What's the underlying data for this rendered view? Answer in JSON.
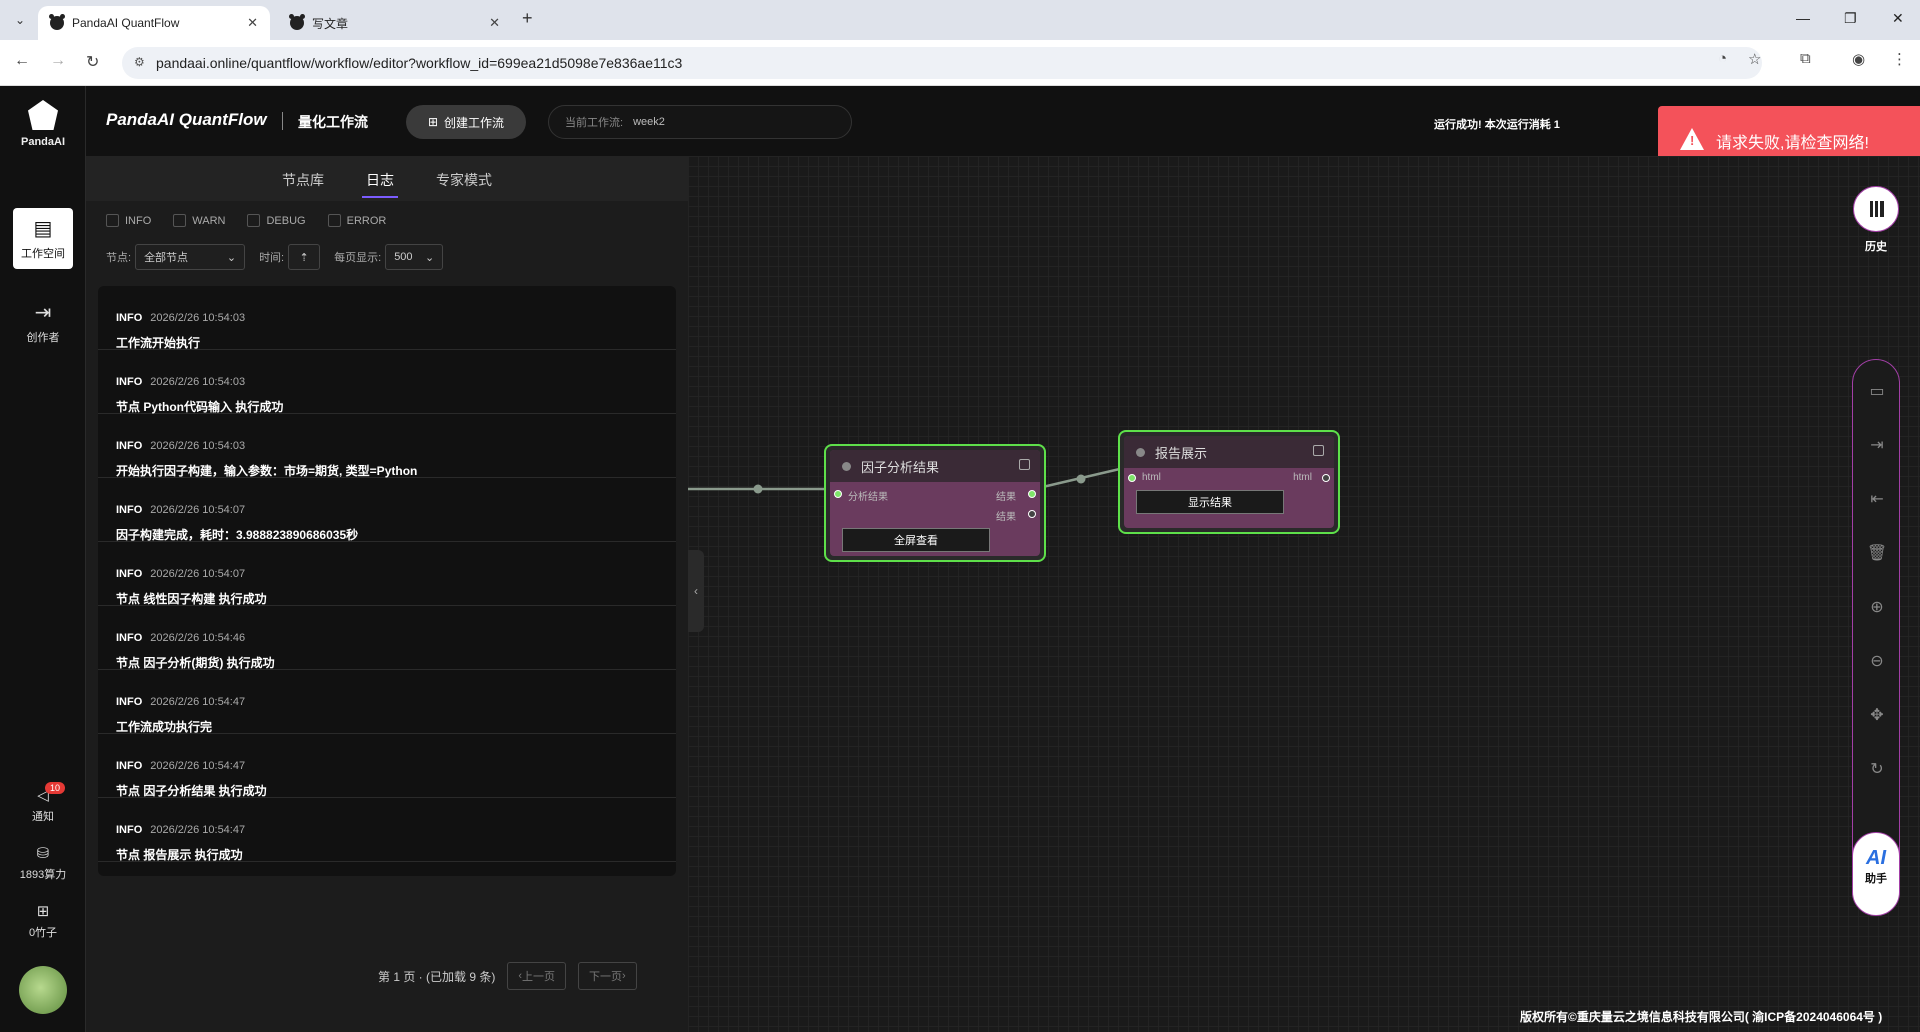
{
  "browser": {
    "tabs": [
      {
        "title": "PandaAI QuantFlow",
        "active": true
      },
      {
        "title": "写文章",
        "active": false
      }
    ],
    "url": "pandaai.online/quantflow/workflow/editor?workflow_id=699ea21d5098e7e836ae11c3"
  },
  "sidebar": {
    "logo_text": "PandaAI",
    "items": [
      {
        "label": "工作空间",
        "icon": "workspace-icon",
        "active": true
      },
      {
        "label": "创作者",
        "icon": "creator-icon",
        "active": false
      }
    ],
    "bottom": [
      {
        "label": "通知",
        "icon": "bell-icon",
        "badge": "10"
      },
      {
        "label": "1893算力",
        "icon": "database-icon"
      },
      {
        "label": "0竹子",
        "icon": "bamboo-icon"
      }
    ]
  },
  "header": {
    "brand": "PandaAI QuantFlow",
    "sub": "量化工作流",
    "create_label": "创建工作流",
    "current_label": "当前工作流:",
    "current_value": "week2",
    "status": "运行成功!  本次运行消耗 1"
  },
  "toast": {
    "message": "请求失败,请检查网络!",
    "color": "#f4525a"
  },
  "panel": {
    "tabs": [
      {
        "label": "节点库",
        "active": false
      },
      {
        "label": "日志",
        "active": true
      },
      {
        "label": "专家模式",
        "active": false
      }
    ],
    "levels": [
      "INFO",
      "WARN",
      "DEBUG",
      "ERROR"
    ],
    "node_label": "节点:",
    "node_value": "全部节点",
    "time_label": "时间:",
    "page_size_label": "每页显示:",
    "page_size": "500",
    "logs": [
      {
        "level": "INFO",
        "time": "2026/2/26 10:54:03",
        "msg": "工作流开始执行"
      },
      {
        "level": "INFO",
        "time": "2026/2/26 10:54:03",
        "msg": "节点 Python代码输入 执行成功"
      },
      {
        "level": "INFO",
        "time": "2026/2/26 10:54:03",
        "msg": "开始执行因子构建，输入参数：市场=期货, 类型=Python"
      },
      {
        "level": "INFO",
        "time": "2026/2/26 10:54:07",
        "msg": "因子构建完成，耗时：3.988823890686035秒"
      },
      {
        "level": "INFO",
        "time": "2026/2/26 10:54:07",
        "msg": "节点 线性因子构建 执行成功"
      },
      {
        "level": "INFO",
        "time": "2026/2/26 10:54:46",
        "msg": "节点 因子分析(期货) 执行成功"
      },
      {
        "level": "INFO",
        "time": "2026/2/26 10:54:47",
        "msg": "工作流成功执行完"
      },
      {
        "level": "INFO",
        "time": "2026/2/26 10:54:47",
        "msg": "节点 因子分析结果 执行成功"
      },
      {
        "level": "INFO",
        "time": "2026/2/26 10:54:47",
        "msg": "节点 报告展示 执行成功"
      }
    ],
    "pager": {
      "info": "第 1 页 · (已加载 9 条)",
      "prev": "上一页",
      "next": "下一页"
    }
  },
  "nodes": {
    "factor": {
      "title": "因子分析结果",
      "in_label": "分析结果",
      "out1": "结果",
      "out2": "结果",
      "button": "全屏查看"
    },
    "report": {
      "title": "报告展示",
      "in_label": "html",
      "out_label": "html",
      "button": "显示结果"
    }
  },
  "right": {
    "history_label": "历史",
    "ai_label": "AI",
    "ai_sub": "助手",
    "tools": [
      "save-icon",
      "export-icon",
      "import-icon",
      "trash-icon",
      "zoom-in-icon",
      "zoom-out-icon",
      "move-icon",
      "refresh-icon"
    ]
  },
  "footer": {
    "copyright": "版权所有©重庆量云之境信息科技有限公司( 渝ICP备2024046064号 )"
  }
}
